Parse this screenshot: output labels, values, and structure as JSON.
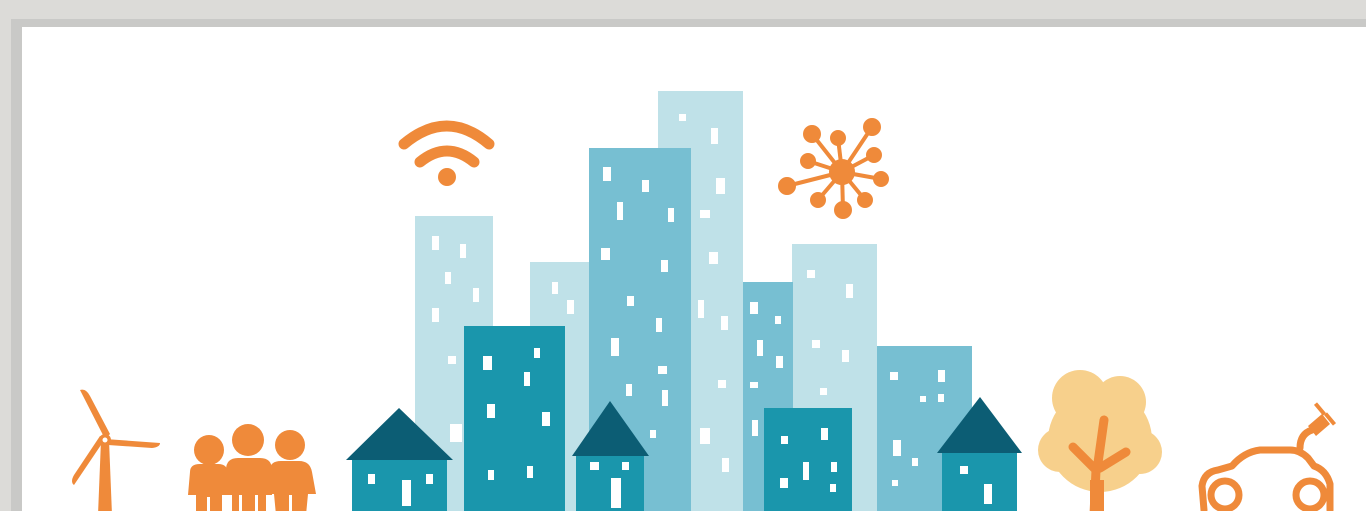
{
  "colors": {
    "page_background": "#dcdbd8",
    "frame": "#c9c9c7",
    "canvas": "#ffffff",
    "accent_orange": "#ef8a3a",
    "tree_canopy": "#f7d08c",
    "building_light": "#bfe1e8",
    "building_mid": "#77bfd2",
    "building_dark": "#1a96ac",
    "roof": "#0c5d74",
    "window": "#ffffff"
  },
  "icons": {
    "wifi": "wifi-icon",
    "network": "network-node-icon",
    "wind_turbine": "wind-turbine-icon",
    "people": "people-group-icon",
    "tree": "tree-icon",
    "electric_car": "electric-car-icon",
    "city": "city-skyline-icon"
  }
}
